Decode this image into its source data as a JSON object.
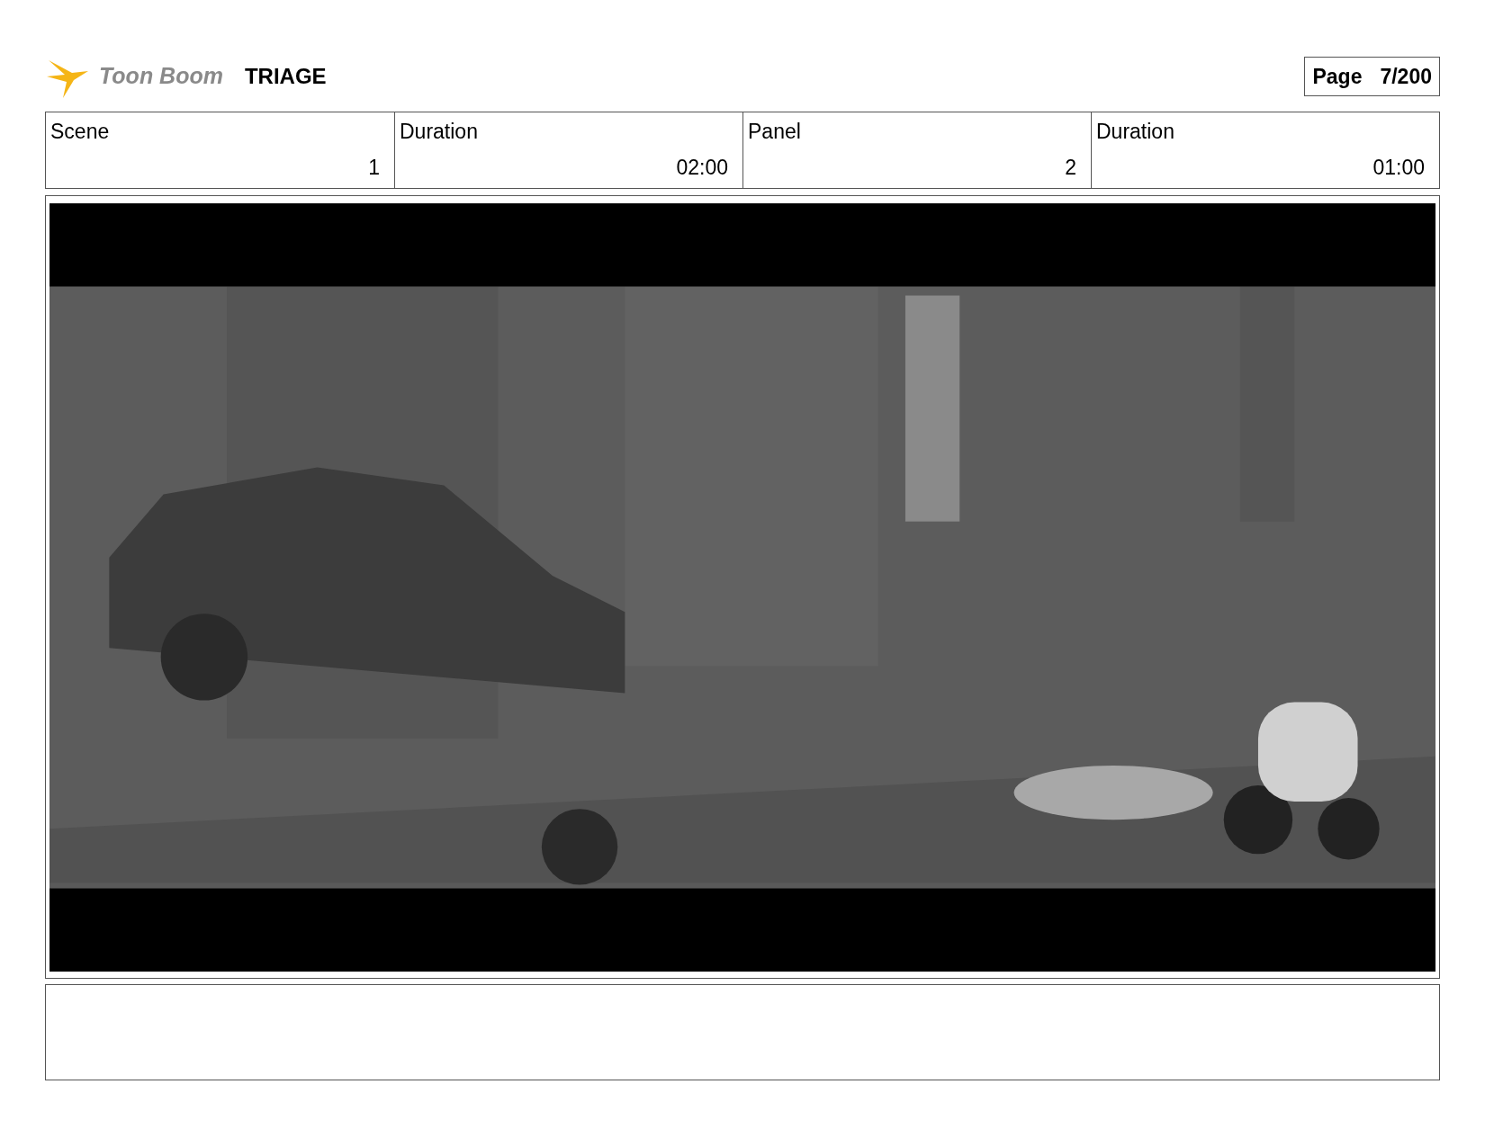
{
  "header": {
    "logo_text": "Toon Boom",
    "project": "TRIAGE",
    "page_label": "Page",
    "page_value": "7/200"
  },
  "fields": [
    {
      "label": "Scene",
      "value": "1"
    },
    {
      "label": "Duration",
      "value": "02:00"
    },
    {
      "label": "Panel",
      "value": "2"
    },
    {
      "label": "Duration",
      "value": "01:00"
    }
  ]
}
